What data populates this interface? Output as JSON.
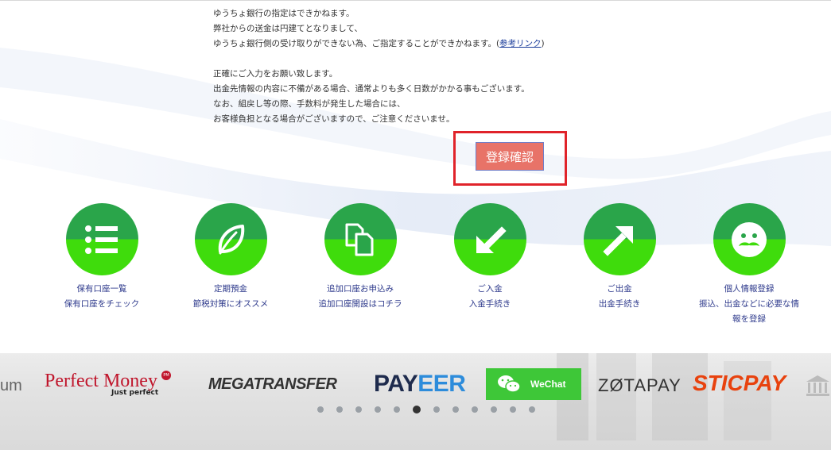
{
  "notice": {
    "line1": "ゆうちょ銀行の指定はできかねます。",
    "line2": "弊社からの送金は円建てとなりまして、",
    "line3_prefix": "ゆうちょ銀行側の受け取りができない為、ご指定することができかねます。(",
    "line3_link": "参考リンク",
    "line3_suffix": ")",
    "line4": "正確にご入力をお願い致します。",
    "line5": "出金先情報の内容に不備がある場合、通常よりも多く日数がかかる事もございます。",
    "line6": "なお、組戻し等の際、手数料が発生した場合には、",
    "line7": "お客様負担となる場合がございますので、ご注意くださいませ。"
  },
  "confirm_button": "登録確認",
  "menu": [
    {
      "title": "保有口座一覧",
      "subtitle": "保有口座をチェック",
      "icon": "list-icon"
    },
    {
      "title": "定期預金",
      "subtitle": "節税対策にオススメ",
      "icon": "leaf-icon"
    },
    {
      "title": "追加口座お申込み",
      "subtitle": "追加口座開設はコチラ",
      "icon": "copy-documents-icon"
    },
    {
      "title": "ご入金",
      "subtitle": "入金手続き",
      "icon": "arrow-down-left-icon"
    },
    {
      "title": "ご出金",
      "subtitle": "出金手続き",
      "icon": "arrow-up-right-icon"
    },
    {
      "title": "個人情報登録",
      "subtitle_line1": "振込、出金などに必要な情",
      "subtitle_line2": "報を登録",
      "icon": "smiley-mustache-icon"
    }
  ],
  "payment_brands": {
    "partial_left": "um",
    "perfect_money": "Perfect Money",
    "perfect_money_badge": "PM",
    "perfect_money_tagline": "Just perfect",
    "megatransfer": "MEGATRANSFER",
    "payeer_pay": "PAY",
    "payeer_eer": "EER",
    "wechat": "WeChat",
    "zotapay": "ZØTAPAY",
    "sticpay": "STICPAY"
  },
  "carousel": {
    "dot_count": 12,
    "active_index": 5
  },
  "colors": {
    "circle_top": "#2aa54a",
    "circle_bottom": "#3fdc0c",
    "menu_text": "#2e3a8c",
    "confirm_button": "#e87368",
    "highlight_frame": "#e0232a"
  }
}
